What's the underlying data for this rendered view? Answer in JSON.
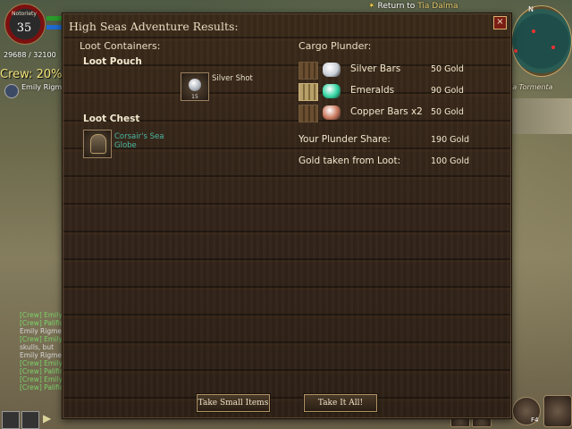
{
  "hud": {
    "notoriety_label": "Notoriety",
    "notoriety_value": "35",
    "hp_text": "29688 / 32100",
    "crew_label": "Crew: 20%",
    "crew_member": "Emily Rigmen"
  },
  "chat": [
    {
      "text": "[Crew] Emily",
      "kind": "crew"
    },
    {
      "text": "[Crew] Palific",
      "kind": "crew"
    },
    {
      "text": "Emily Rigmen",
      "kind": "npc"
    },
    {
      "text": "[Crew] Emily",
      "kind": "crew"
    },
    {
      "text": "skulls, but",
      "kind": "npc"
    },
    {
      "text": "Emily Rigmen",
      "kind": "npc"
    },
    {
      "text": "[Crew] Emily",
      "kind": "crew"
    },
    {
      "text": "[Crew] Palific",
      "kind": "crew"
    },
    {
      "text": "[Crew] Emily",
      "kind": "crew"
    },
    {
      "text": "[Crew] Palific",
      "kind": "crew"
    }
  ],
  "top_right": {
    "return_prefix": "Return to",
    "return_destination": "Tia Dalma",
    "compass_n": "N",
    "location": "la Tormenta"
  },
  "bottom_right": {
    "f4_label": "F4"
  },
  "panel": {
    "title": "High Seas Adventure Results:",
    "close_symbol": "×",
    "loot_containers_heading": "Loot Containers:",
    "loot_pouch_heading": "Loot Pouch",
    "silver_shot": {
      "label": "Silver Shot",
      "quantity": "15"
    },
    "loot_chest_heading": "Loot Chest",
    "globe": {
      "label": "Corsair's Sea Globe"
    },
    "cargo_heading": "Cargo Plunder:",
    "cargo": [
      {
        "name": "Silver Bars",
        "value": "50 Gold",
        "gem_color": "#c9ced6",
        "crate": "wood",
        "icon": "silver-bars-icon"
      },
      {
        "name": "Emeralds",
        "value": "90 Gold",
        "gem_color": "#2fd3a0",
        "crate": "gold",
        "icon": "emeralds-icon"
      },
      {
        "name": "Copper Bars x2",
        "value": "50 Gold",
        "gem_color": "#c8755a",
        "crate": "wood",
        "icon": "copper-bars-icon"
      }
    ],
    "plunder_share_label": "Your Plunder Share:",
    "plunder_share_value": "190 Gold",
    "gold_taken_label": "Gold taken from Loot:",
    "gold_taken_value": "100 Gold",
    "btn_take_small": "Take Small Items",
    "btn_take_all": "Take It All!"
  }
}
